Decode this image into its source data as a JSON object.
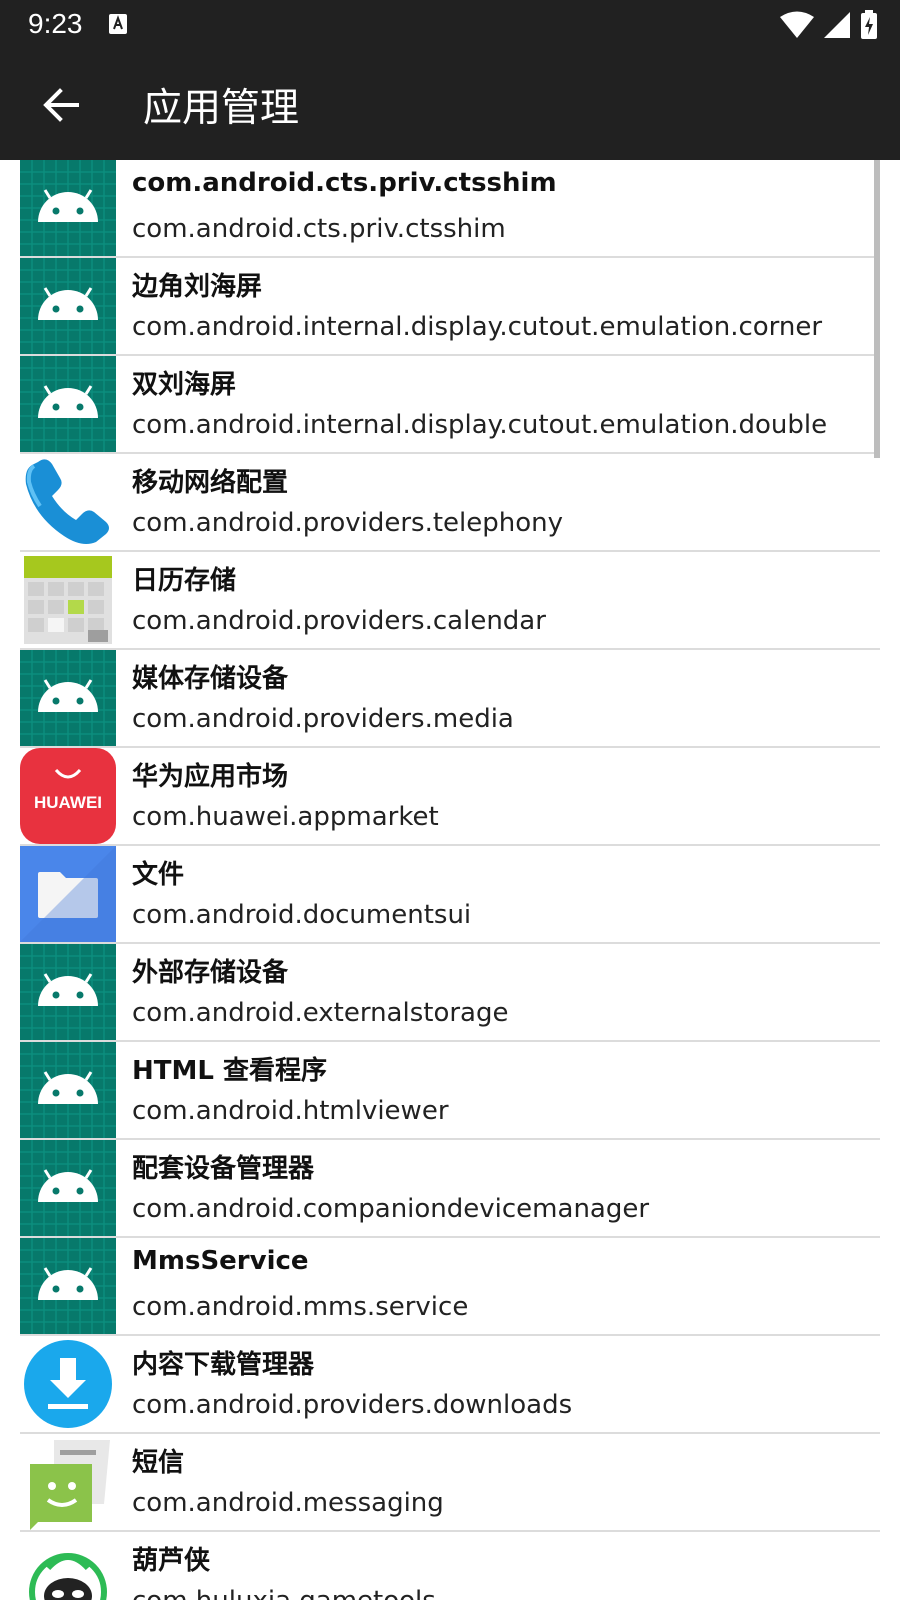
{
  "status_bar": {
    "time": "9:23"
  },
  "app_bar": {
    "title": "应用管理"
  },
  "apps": [
    {
      "name": "com.android.cts.priv.ctsshim",
      "package": "com.android.cts.priv.ctsshim",
      "icon": "android-robot-icon"
    },
    {
      "name": "边角刘海屏",
      "package": "com.android.internal.display.cutout.emulation.corner",
      "icon": "android-robot-icon"
    },
    {
      "name": "双刘海屏",
      "package": "com.android.internal.display.cutout.emulation.double",
      "icon": "android-robot-icon"
    },
    {
      "name": "移动网络配置",
      "package": "com.android.providers.telephony",
      "icon": "phone-icon"
    },
    {
      "name": "日历存储",
      "package": "com.android.providers.calendar",
      "icon": "calendar-icon"
    },
    {
      "name": "媒体存储设备",
      "package": "com.android.providers.media",
      "icon": "android-robot-icon"
    },
    {
      "name": "华为应用市场",
      "package": "com.huawei.appmarket",
      "icon": "huawei-appmarket-icon",
      "icon_text": "HUAWEI"
    },
    {
      "name": "文件",
      "package": "com.android.documentsui",
      "icon": "folder-icon"
    },
    {
      "name": "外部存储设备",
      "package": "com.android.externalstorage",
      "icon": "android-robot-icon"
    },
    {
      "name": "HTML 查看程序",
      "package": "com.android.htmlviewer",
      "icon": "android-robot-icon"
    },
    {
      "name": "配套设备管理器",
      "package": "com.android.companiondevicemanager",
      "icon": "android-robot-icon"
    },
    {
      "name": "MmsService",
      "package": "com.android.mms.service",
      "icon": "android-robot-icon"
    },
    {
      "name": "内容下载管理器",
      "package": "com.android.providers.downloads",
      "icon": "download-icon"
    },
    {
      "name": "短信",
      "package": "com.android.messaging",
      "icon": "messaging-icon"
    },
    {
      "name": "葫芦侠",
      "package": "com.huluxia.gametools",
      "icon": "huluxia-icon"
    }
  ],
  "colors": {
    "app_bar": "#212121",
    "android_icon_bg": "#07796b",
    "android_robot": "#ffffff",
    "huawei_red": "#e8323f",
    "folder_blue": "#4a86ea",
    "download_blue": "#1aa8ec",
    "messaging_green": "#8bc34a"
  }
}
